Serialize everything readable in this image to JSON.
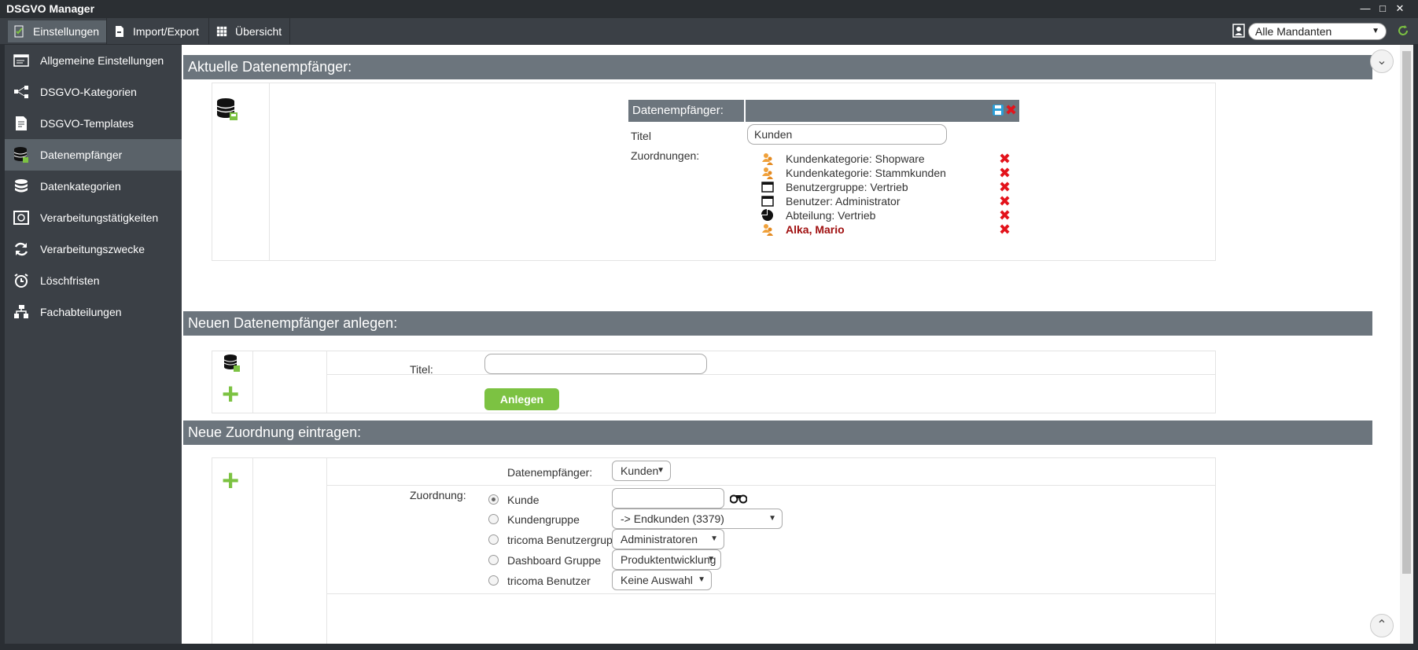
{
  "app": {
    "title": "DSGVO Manager"
  },
  "menu": {
    "items": [
      {
        "label": "Einstellungen",
        "icon": "checklist-icon"
      },
      {
        "label": "Import/Export",
        "icon": "document-arrow-icon"
      },
      {
        "label": "Übersicht",
        "icon": "grid-icon"
      }
    ],
    "mandant_select": "Alle Mandanten"
  },
  "sidebar": {
    "items": [
      {
        "label": "Allgemeine Einstellungen",
        "icon": "window-icon"
      },
      {
        "label": "DSGVO-Kategorien",
        "icon": "hierarchy-icon"
      },
      {
        "label": "DSGVO-Templates",
        "icon": "template-icon"
      },
      {
        "label": "Datenempfänger",
        "icon": "database-icon"
      },
      {
        "label": "Datenkategorien",
        "icon": "stack-icon"
      },
      {
        "label": "Verarbeitungstätigkeiten",
        "icon": "safe-icon"
      },
      {
        "label": "Verarbeitungszwecke",
        "icon": "refresh-icon"
      },
      {
        "label": "Löschfristen",
        "icon": "alarm-clock-icon"
      },
      {
        "label": "Fachabteilungen",
        "icon": "org-chart-icon"
      }
    ]
  },
  "current": {
    "heading": "Aktuelle Datenempfänger:",
    "detail_heading": "Datenempfänger:",
    "title_label": "Titel",
    "title_value": "Kunden",
    "assign_label": "Zuordnungen:",
    "assignments": [
      {
        "label": "Kundenkategorie: Shopware",
        "icon": "users-icon"
      },
      {
        "label": "Kundenkategorie: Stammkunden",
        "icon": "users-icon"
      },
      {
        "label": "Benutzergruppe: Vertrieb",
        "icon": "window-icon"
      },
      {
        "label": "Benutzer: Administrator",
        "icon": "window-icon"
      },
      {
        "label": "Abteilung: Vertrieb",
        "icon": "pie-icon"
      },
      {
        "label": "Alka, Mario",
        "icon": "users-icon"
      }
    ]
  },
  "create": {
    "heading": "Neuen Datenempfänger anlegen:",
    "title_label": "Titel:",
    "title_value": "",
    "button": "Anlegen"
  },
  "assign_new": {
    "heading": "Neue Zuordnung eintragen:",
    "recipient_label": "Datenempfänger:",
    "recipient_value": "Kunden",
    "assign_label": "Zuordnung:",
    "options": [
      {
        "label": "Kunde",
        "value": "",
        "checked": true
      },
      {
        "label": "Kundengruppe",
        "value": "-> Endkunden (3379)"
      },
      {
        "label": "tricoma Benutzergruppe",
        "value": "Administratoren"
      },
      {
        "label": "Dashboard Gruppe",
        "value": "Produktentwicklung"
      },
      {
        "label": "tricoma Benutzer",
        "value": "Keine Auswahl"
      }
    ]
  },
  "colors": {
    "accent_green": "#7cc242",
    "delete_red": "#e3131b",
    "header_gray": "#6c757d",
    "sidebar_bg": "#3b4046"
  }
}
